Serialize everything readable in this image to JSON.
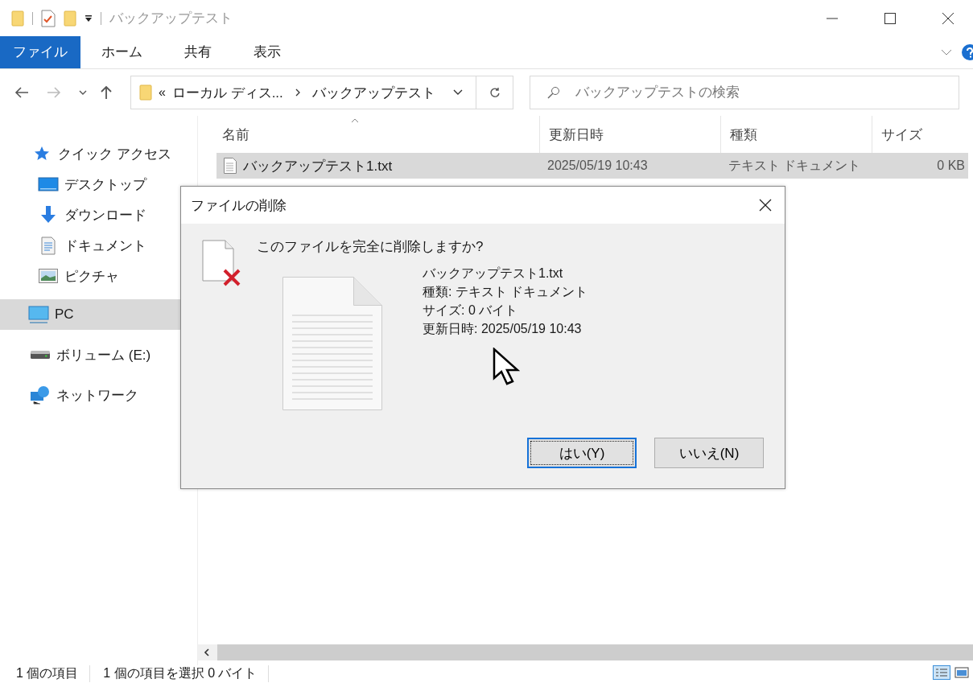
{
  "window": {
    "title": "バックアップテスト"
  },
  "ribbon": {
    "tabs": [
      {
        "label": "ファイル",
        "selected": true
      },
      {
        "label": "ホーム",
        "selected": false
      },
      {
        "label": "共有",
        "selected": false
      },
      {
        "label": "表示",
        "selected": false
      }
    ]
  },
  "address": {
    "overflow": "«",
    "segments": [
      "ローカル ディス...",
      "バックアップテスト"
    ]
  },
  "search": {
    "placeholder": "バックアップテストの検索"
  },
  "sidebar": {
    "items": [
      {
        "label": "クイック アクセス",
        "kind": "star",
        "selected": false,
        "children": [
          {
            "label": "デスクトップ",
            "kind": "desktop",
            "selected": false
          },
          {
            "label": "ダウンロード",
            "kind": "download",
            "selected": false
          },
          {
            "label": "ドキュメント",
            "kind": "document",
            "selected": false
          },
          {
            "label": "ピクチャ",
            "kind": "picture",
            "selected": false
          }
        ]
      },
      {
        "label": "PC",
        "kind": "pc",
        "selected": true
      },
      {
        "label": "ボリューム (E:)",
        "kind": "drive",
        "selected": false
      },
      {
        "label": "ネットワーク",
        "kind": "network",
        "selected": false
      }
    ]
  },
  "table": {
    "columns": [
      {
        "label": "名前",
        "sorted": true
      },
      {
        "label": "更新日時",
        "sorted": false
      },
      {
        "label": "種類",
        "sorted": false
      },
      {
        "label": "サイズ",
        "sorted": false
      }
    ],
    "rows": [
      {
        "name": "バックアップテスト1.txt",
        "modified": "2025/05/19 10:43",
        "type": "テキスト ドキュメント",
        "size": "0 KB",
        "selected": true
      }
    ]
  },
  "dialog": {
    "title": "ファイルの削除",
    "question": "このファイルを完全に削除しますか?",
    "file_name": "バックアップテスト1.txt",
    "details": [
      "種類: テキスト ドキュメント",
      "サイズ: 0 バイト",
      "更新日時: 2025/05/19 10:43"
    ],
    "buttons": [
      {
        "label": "はい(Y)",
        "focused": true
      },
      {
        "label": "いいえ(N)",
        "focused": false
      }
    ]
  },
  "status_bar": [
    "1 個の項目",
    "1 個の項目を選択 0 バイト"
  ]
}
